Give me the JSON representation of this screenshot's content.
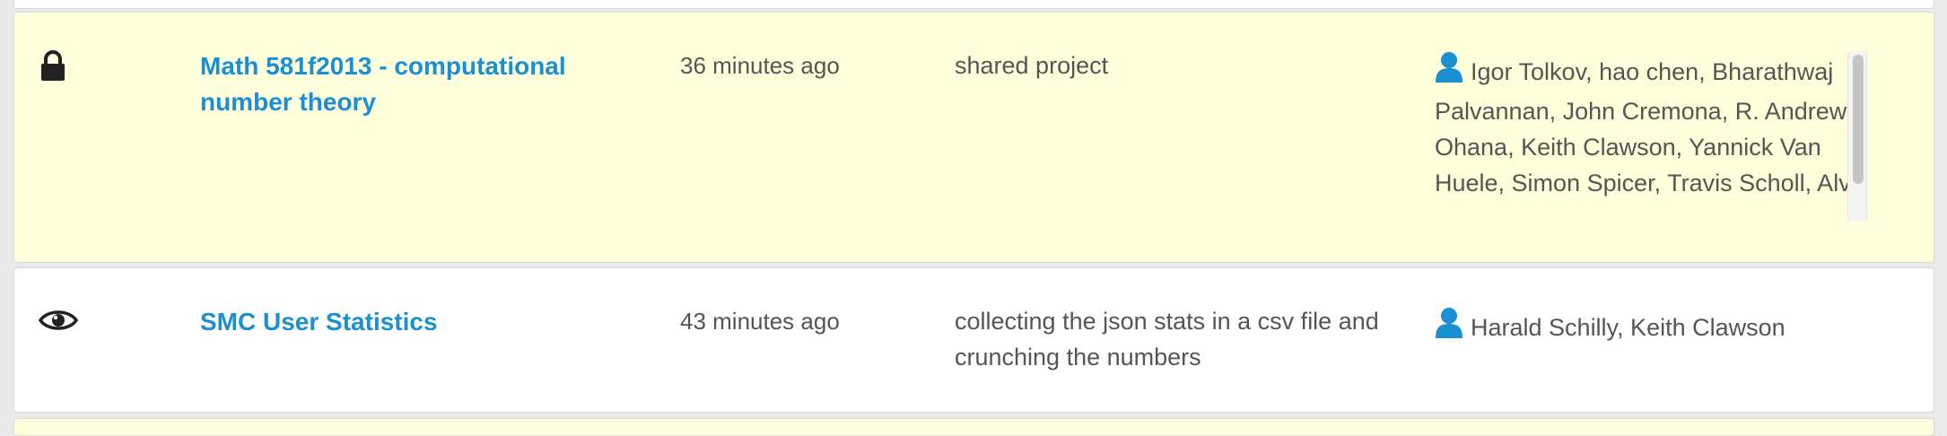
{
  "projects": [
    {
      "visibility_icon": "lock-icon",
      "title": "Math 581f2013 - computational number theory",
      "modified": "36 minutes ago",
      "description": "shared project",
      "user_icon": "user-icon",
      "collaborators": "Igor Tolkov, hao chen, Bharathwaj Palvannan, John Cremona, R. Andrew Ohana, Keith Clawson, Yannick Van Huele, Simon Spicer, Travis Scholl, Alv"
    },
    {
      "visibility_icon": "eye-icon",
      "title": "SMC User Statistics",
      "modified": "43 minutes ago",
      "description": "collecting the json stats in a csv file and crunching the numbers",
      "user_icon": "user-icon",
      "collaborators": "Harald Schilly, Keith Clawson"
    }
  ],
  "colors": {
    "link": "#1a8fd1",
    "text": "#555555",
    "row_highlight": "#ffffdc",
    "row_plain": "#ffffff"
  }
}
